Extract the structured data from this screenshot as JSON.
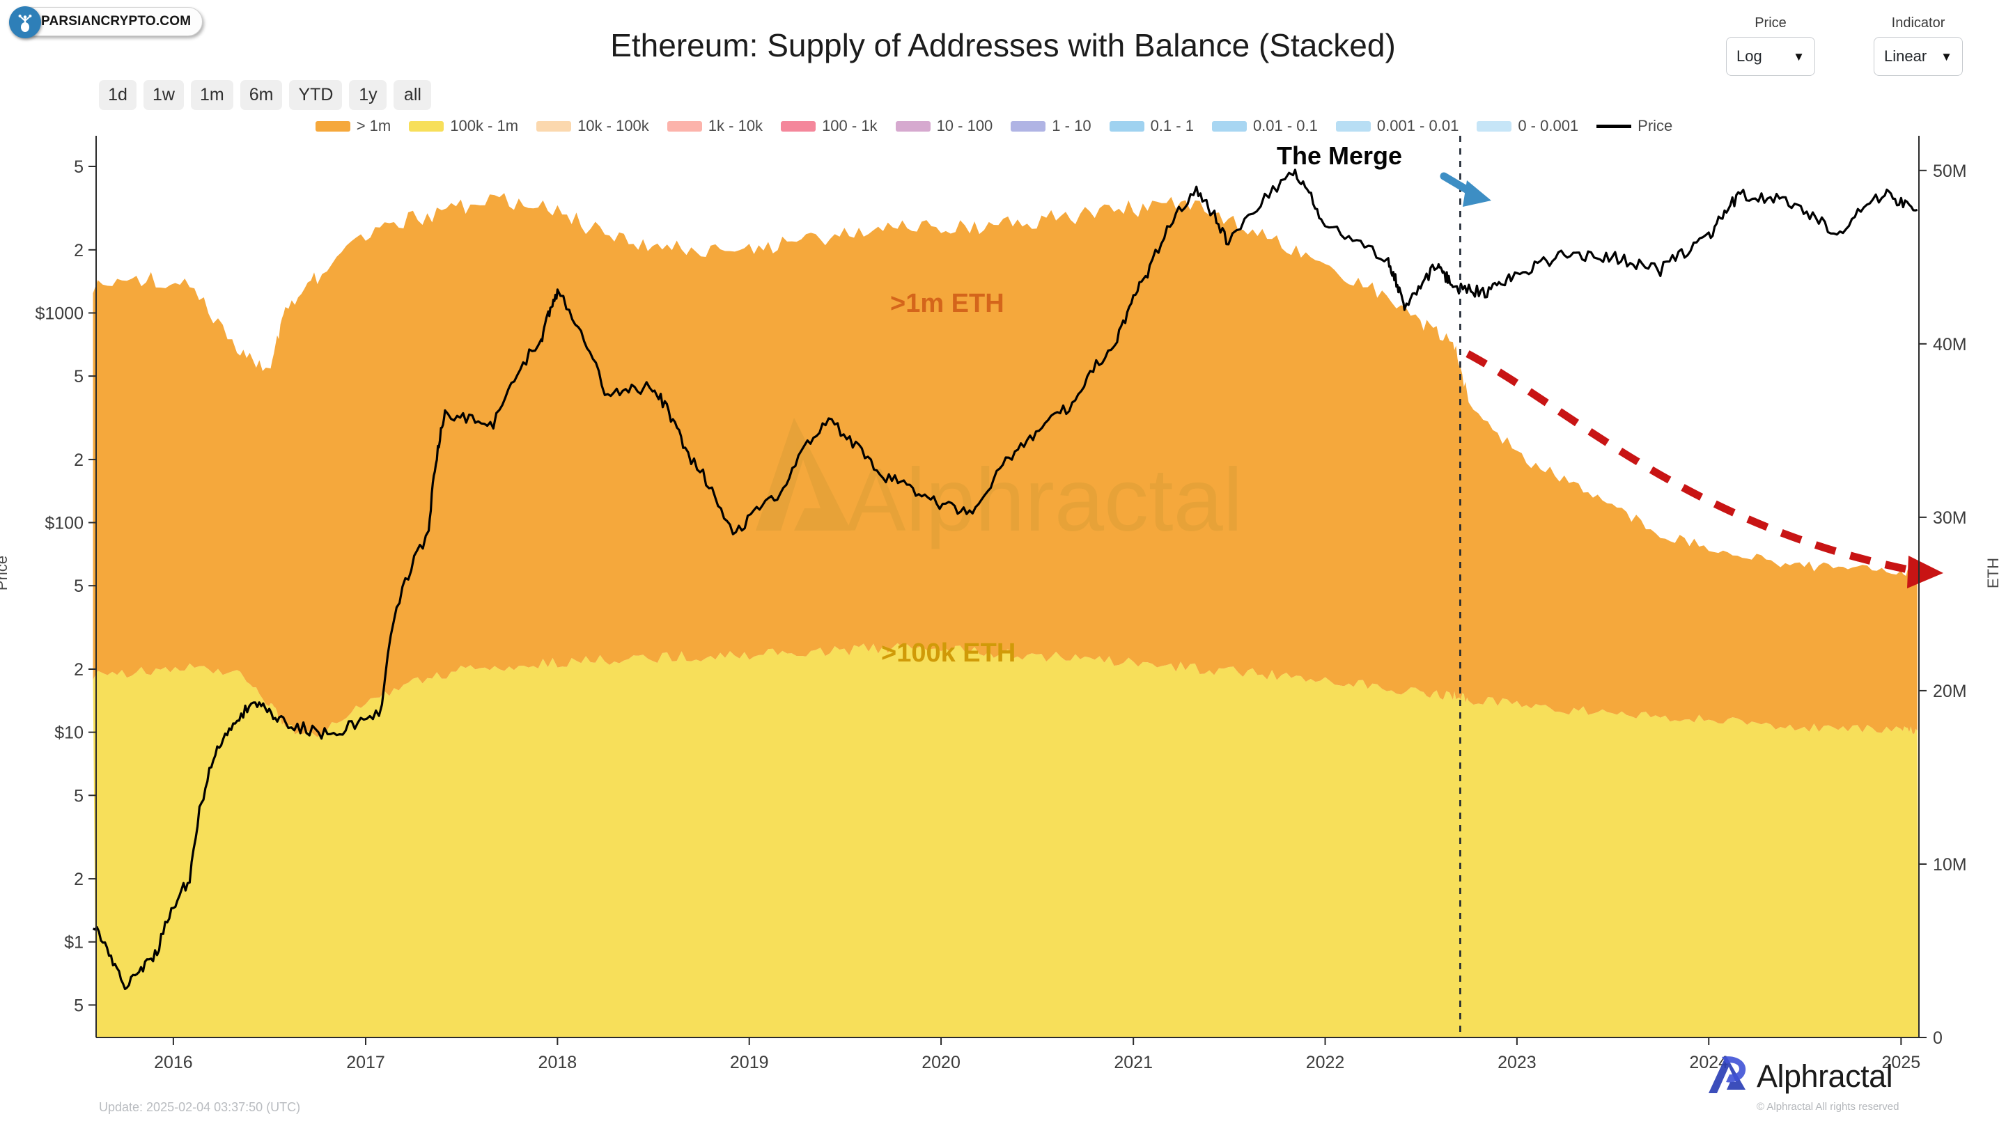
{
  "watermark_badge": {
    "text": "PARSIANCRYPTO.COM",
    "icon": "parsiancrypto-logo-icon"
  },
  "header": {
    "title": "Ethereum: Supply of Addresses with Balance (Stacked)"
  },
  "range_buttons": [
    {
      "label": "1d"
    },
    {
      "label": "1w"
    },
    {
      "label": "1m"
    },
    {
      "label": "6m"
    },
    {
      "label": "YTD"
    },
    {
      "label": "1y"
    },
    {
      "label": "all"
    }
  ],
  "controls": {
    "price": {
      "label": "Price",
      "value": "Log",
      "caret": "▼"
    },
    "indicator": {
      "label": "Indicator",
      "value": "Linear",
      "caret": "▼"
    }
  },
  "annotations": {
    "merge": "The Merge",
    "band_1m": ">1m ETH",
    "band_100k": ">100k ETH",
    "watermark_center": "Alphractal"
  },
  "footer": {
    "update": "Update: 2025-02-04 03:37:50 (UTC)",
    "brand_name": "Alphractal",
    "copyright": "© Alphractal All rights reserved"
  },
  "chart_data": {
    "type": "area",
    "title": "Ethereum: Supply of Addresses with Balance (Stacked)",
    "subtitle": "",
    "xlabel": "",
    "ylabel": "Price",
    "y2label": "ETH",
    "grid": false,
    "legend_position": "top-center",
    "x_axis": {
      "tick_labels": [
        "2016",
        "2017",
        "2018",
        "2019",
        "2020",
        "2021",
        "2022",
        "2023",
        "2024",
        "2025"
      ],
      "range": [
        "2015-08",
        "2025-02"
      ]
    },
    "y_axis_left": {
      "label": "Price",
      "scale": "log",
      "tick_labels": [
        "5",
        "2",
        "$1000",
        "5",
        "2",
        "$100",
        "5",
        "2",
        "$10",
        "5",
        "2",
        "$1",
        "5"
      ],
      "tick_values": [
        5000,
        2000,
        1000,
        500,
        200,
        100,
        50,
        20,
        10,
        5,
        2,
        1,
        0.5
      ],
      "range": [
        0.35,
        7000
      ]
    },
    "y_axis_right": {
      "label": "ETH",
      "scale": "linear",
      "tick_labels": [
        "0",
        "10M",
        "20M",
        "30M",
        "40M",
        "50M"
      ],
      "tick_values": [
        0,
        10000000,
        20000000,
        30000000,
        40000000,
        50000000
      ],
      "range": [
        0,
        52000000
      ]
    },
    "legend": [
      {
        "label": "> 1m",
        "color": "#f5a83c",
        "type": "area"
      },
      {
        "label": "100k - 1m",
        "color": "#f7df5a",
        "type": "area"
      },
      {
        "label": "10k - 100k",
        "color": "#fbd8ae",
        "type": "area"
      },
      {
        "label": "1k - 10k",
        "color": "#fcb3ab",
        "type": "area"
      },
      {
        "label": "100 - 1k",
        "color": "#f4879b",
        "type": "area"
      },
      {
        "label": "10 - 100",
        "color": "#d6a9cf",
        "type": "area"
      },
      {
        "label": "1 - 10",
        "color": "#b0b4e4",
        "type": "area"
      },
      {
        "label": "0.1 - 1",
        "color": "#9fd2f0",
        "type": "area"
      },
      {
        "label": "0.01 - 0.1",
        "color": "#a8d6f2",
        "type": "area"
      },
      {
        "label": "0.001 - 0.01",
        "color": "#b8def4",
        "type": "area"
      },
      {
        "label": "0 - 0.001",
        "color": "#c6e5f7",
        "type": "area"
      },
      {
        "label": "Price",
        "color": "#000000",
        "type": "line"
      }
    ],
    "series": [
      {
        "name": "100k - 1m",
        "color": "#f7df5a",
        "axis": "right",
        "unit": "ETH",
        "x": [
          "2015-08",
          "2015-11",
          "2016-02",
          "2016-05",
          "2016-07",
          "2016-08",
          "2016-10",
          "2017-01",
          "2017-04",
          "2017-07",
          "2017-10",
          "2018-01",
          "2018-04",
          "2018-07",
          "2018-10",
          "2019-01",
          "2019-04",
          "2019-07",
          "2019-10",
          "2020-01",
          "2020-04",
          "2020-07",
          "2020-10",
          "2021-01",
          "2021-04",
          "2021-07",
          "2021-10",
          "2022-01",
          "2022-04",
          "2022-07",
          "2022-09",
          "2022-10",
          "2023-01",
          "2023-04",
          "2023-07",
          "2023-10",
          "2024-01",
          "2024-04",
          "2024-07",
          "2024-10",
          "2025-01",
          "2025-02"
        ],
        "values": [
          20900000,
          21100000,
          21300000,
          21000000,
          19300000,
          17900000,
          17300000,
          19400000,
          20500000,
          21200000,
          21400000,
          21600000,
          21800000,
          21900000,
          22000000,
          22100000,
          22200000,
          22300000,
          22500000,
          22400000,
          22200000,
          22000000,
          21800000,
          21600000,
          21400000,
          21100000,
          20900000,
          20700000,
          20300000,
          19900000,
          19700000,
          19500000,
          19200000,
          18900000,
          18700000,
          18500000,
          18300000,
          18100000,
          17900000,
          17800000,
          17700000,
          17700000
        ]
      },
      {
        "name": "> 1m",
        "color": "#f5a83c",
        "axis": "right",
        "unit": "ETH",
        "stacked_on": "100k - 1m",
        "x": [
          "2015-08",
          "2015-11",
          "2016-02",
          "2016-05",
          "2016-07",
          "2016-08",
          "2016-10",
          "2017-01",
          "2017-04",
          "2017-07",
          "2017-10",
          "2018-01",
          "2018-04",
          "2018-07",
          "2018-10",
          "2019-01",
          "2019-04",
          "2019-07",
          "2019-10",
          "2020-01",
          "2020-04",
          "2020-07",
          "2020-10",
          "2021-01",
          "2021-04",
          "2021-07",
          "2021-10",
          "2022-01",
          "2022-04",
          "2022-07",
          "2022-09",
          "2022-10",
          "2023-01",
          "2023-04",
          "2023-07",
          "2023-10",
          "2024-01",
          "2024-04",
          "2024-07",
          "2024-10",
          "2025-01",
          "2025-02"
        ],
        "cumulative_top": [
          43200000,
          43800000,
          43500000,
          39600000,
          38500000,
          41700000,
          43900000,
          46100000,
          47200000,
          47800000,
          48300000,
          47600000,
          46300000,
          45600000,
          45400000,
          45500000,
          45800000,
          46300000,
          46800000,
          46900000,
          46700000,
          47100000,
          47500000,
          47800000,
          48100000,
          47200000,
          45900000,
          44700000,
          43100000,
          41300000,
          40200000,
          36800000,
          33600000,
          32200000,
          30600000,
          29100000,
          28200000,
          27600000,
          27200000,
          27000000,
          26900000,
          26900000
        ]
      },
      {
        "name": "Price",
        "color": "#000000",
        "axis": "left",
        "unit": "USD",
        "x": [
          "2015-08",
          "2015-10",
          "2015-12",
          "2016-02",
          "2016-04",
          "2016-06",
          "2016-08",
          "2016-11",
          "2017-02",
          "2017-05",
          "2017-06",
          "2017-09",
          "2017-12",
          "2018-01",
          "2018-04",
          "2018-07",
          "2018-09",
          "2018-12",
          "2019-03",
          "2019-06",
          "2019-09",
          "2019-12",
          "2020-03",
          "2020-06",
          "2020-09",
          "2020-12",
          "2021-02",
          "2021-05",
          "2021-07",
          "2021-11",
          "2022-01",
          "2022-05",
          "2022-06",
          "2022-08",
          "2022-09",
          "2022-11",
          "2023-01",
          "2023-04",
          "2023-07",
          "2023-10",
          "2024-01",
          "2024-03",
          "2024-06",
          "2024-09",
          "2024-12",
          "2025-02"
        ],
        "values": [
          1.2,
          0.6,
          0.9,
          2.0,
          9.0,
          14.0,
          11.0,
          9.6,
          13.0,
          90.0,
          330.0,
          290.0,
          750.0,
          1250.0,
          400.0,
          450.0,
          220.0,
          85.0,
          140.0,
          310.0,
          175.0,
          130.0,
          110.0,
          230.0,
          360.0,
          730.0,
          1600.0,
          3900.0,
          2100.0,
          4700.0,
          2600.0,
          1800.0,
          1000.0,
          1700.0,
          1330.0,
          1250.0,
          1550.0,
          1900.0,
          1850.0,
          1600.0,
          2300.0,
          3700.0,
          3400.0,
          2400.0,
          3700.0,
          3100.0
        ]
      }
    ],
    "markers": [
      {
        "type": "vline",
        "label": "The Merge",
        "x": "2022-09-15",
        "style": "dashed",
        "color": "#1c2430"
      },
      {
        "type": "arrow",
        "label": "merge-pointer",
        "color": "#3d8ec4"
      },
      {
        "type": "trend-arrow",
        "label": "supply-decline-trend",
        "color": "#c81414",
        "style": "dashed",
        "from": [
          "2022-09",
          39500000
        ],
        "to": [
          "2025-02",
          27000000
        ]
      }
    ]
  }
}
